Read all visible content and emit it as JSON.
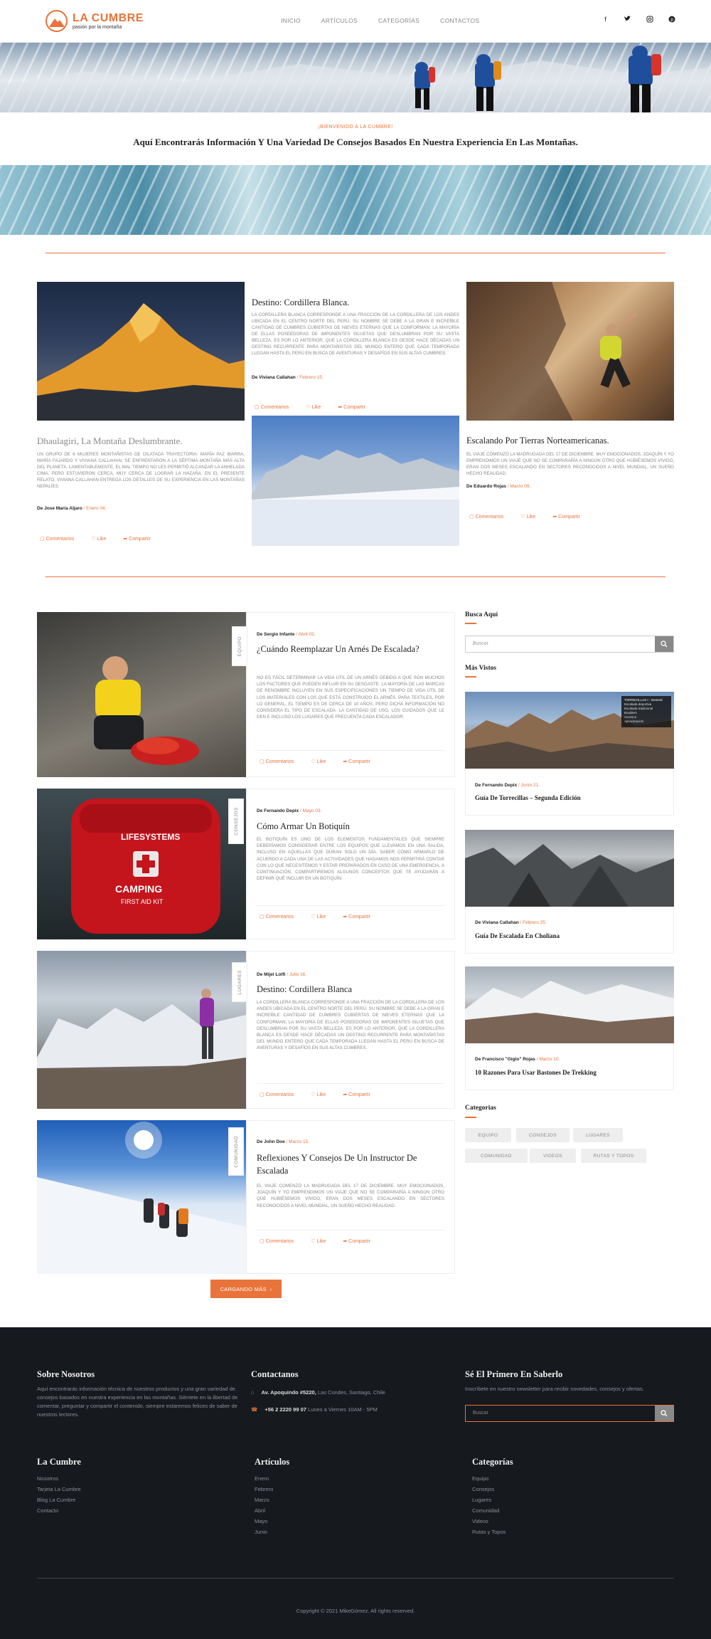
{
  "header": {
    "logo_title": "LA CUMBRE",
    "logo_sub": "pasión por la montaña",
    "nav": [
      "INICIO",
      "ARTÍCULOS",
      "CATEGORÍAS",
      "CONTACTOS"
    ],
    "social": [
      "facebook-icon",
      "twitter-icon",
      "instagram-icon",
      "pinterest-icon"
    ]
  },
  "welcome": {
    "small": "¡BIENVENIDO A LA CUMBRE!",
    "big": "Aquí Encontrarás Información Y Una Variedad De Consejos Basados En Nuestra Experiencia En Las Montañas."
  },
  "featured": [
    {
      "title": "Destino: Cordillera Blanca.",
      "desc": "La Cordillera Blanca corresponde a una fracción de la cordillera de los Andes ubicada en el centro norte del Perú. Su nombre se debe a la gran e increíble cantidad de cumbres cubiertas de nieves eternas que la conforman; la mayoría de ellas poseedoras de imponentes siluetas que deslumbran por su vasta belleza. Es por lo anterior, que la Cordillera Blanca es desde hace décadas un destino recurrente para montañistas del mundo entero que cada temporada llegan hasta el Perú en busca de aventuras y desafíos en sus altas cumbres.",
      "author": "De Viviana Callahan",
      "date": "Febrero 15.",
      "actions": [
        "Comentarios",
        "Like",
        "Compartir"
      ]
    },
    {
      "title": "Dhaulagiri, La Montaña Deslumbrante.",
      "desc": "Un grupo de 6 mujeres montañistas de dilatada trayectoria: María Paz Ibarra, María Fajardo y Viviana Callahan, se enfrentaron a la séptima montaña más alta del planeta. Lamentablemente, el mal tiempo no les permitió alcanzar la anhelada cima, pero estuvieron cerca, muy cerca de lograr la hazaña. En el presente relato, Viviana Callahan entrega los detalles de su experiencia en las montañas nepalíes.",
      "author": "De Jose María Aljaro",
      "date": "Enero 04.",
      "actions": [
        "Comentarios",
        "Like",
        "Compartir"
      ]
    },
    {
      "title": "Escalando Por Tierras Norteamericanas.",
      "desc": "El viaje comenzó la madrugada del 17 de diciembre. Muy emocionados, Joaquín y yo emprendimos un viaje que no se compararía a ningún otro que hubiésemos vivido, eran dos meses escalando en sectores reconocidos a nivel mundial, un sueño hecho realidad.",
      "author": "De Eduardo Rojas",
      "date": "Marzo 09.",
      "actions": [
        "Comentarios",
        "Like",
        "Compartir"
      ]
    }
  ],
  "posts": [
    {
      "tag": "EQUIPO",
      "author": "De Sergio Infante",
      "date": "Abril 03.",
      "title": "¿Cuándo Reemplazar Un Arnés De Escalada?",
      "desc": "No es fácil determinar la vida útil de un arnés debido a que son muchos los factores que pueden influir en su desgaste. La mayoría de las marcas de renombre incluyen en sus especificaciones un tiempo de vida útil de los materiales con los que está construido el arnés. Para textiles, por lo general, el tiempo es de cerca de 10 años, pero dicha información no considera el tipo de escalada, la cantidad de uso, los cuidados que le den e incluso los lugares que frecuenta cada escalador.",
      "actions": [
        "Comentarios",
        "Like",
        "Compartir"
      ]
    },
    {
      "tag": "CONSEJOS",
      "author": "De Fernando Depix",
      "date": "Mayo 03.",
      "title": "Cómo Armar Un Botiquín",
      "desc": "El botiquín es uno de los elementos fundamentales que siempre deberíamos considerar entre los equipos que llevamos en una salida, incluso en aquellas que duran solo un día. Saber cómo armarlo de acuerdo a cada una de las actividades que hagamos nos permitirá contar con lo que necesitemos y estar preparados en caso de una emergencia. A continuación, compartiremos algunos conceptos que te ayudarán a definir qué incluir en un botiquín.",
      "actions": [
        "Comentarios",
        "Like",
        "Compartir"
      ]
    },
    {
      "tag": "LUGARES",
      "author": "De Mijel Lotfi",
      "date": "Julio 16.",
      "title": "Destino: Cordillera Blanca",
      "desc": "La Cordillera Blanca corresponde a una fracción de la cordillera de los Andes ubicada en el centro norte del Perú. Su nombre se debe a la gran e increíble cantidad de cumbres cubiertas de nieves eternas que la conforman; la mayoría de ellas poseedoras de imponentes siluetas que deslumbran por su vasta belleza. Es por lo anterior, que la Cordillera Blanca es desde hace décadas un destino recurrente para montañistas del mundo entero que cada temporada llegan hasta el Perú en busca de aventuras y desafíos en sus altas cumbres.",
      "actions": [
        "Comentarios",
        "Like",
        "Compartir"
      ]
    },
    {
      "tag": "COMUNIDAD",
      "author": "De John Doe",
      "date": "Marzo 15.",
      "title": "Reflexiones Y Consejos De Un Instructor De Escalada",
      "desc": "El viaje comenzó la madrugada del 17 de diciembre. Muy emocionados, Joaquín y yo emprendimos un viaje que no se compararía a ningún otro que hubiésemos vivido, eran dos meses escalando en sectores reconocidos a nivel mundial, un sueño hecho realidad.",
      "actions": [
        "Comentarios",
        "Like",
        "Compartir"
      ]
    }
  ],
  "load_more": "CARGANDO MÁS",
  "sidebar": {
    "search_title": "Busca Aquí",
    "search_placeholder": "Buscar",
    "popular_title": "Más Vistos",
    "popular": [
      {
        "author": "De Fernando Depix",
        "date": "Junio 21.",
        "title": "Guía De Torrecillas – Segunda Edición",
        "overlay": [
          "TORRECILLAS I - General",
          "Escalada deportiva",
          "Escalada tradicional",
          "Boulders",
          "Accesos",
          "Aproximación"
        ]
      },
      {
        "author": "De Viviana Callahan",
        "date": "Febrero 25.",
        "title": "Guía De Escalada En Choliana"
      },
      {
        "author": "De Francisco \"Gigio\" Rojas",
        "date": "Marzo 10.",
        "title": "10 Razones Para Usar Bastones De Trekking"
      }
    ],
    "categories_title": "Categorias",
    "tags": [
      "EQUIPO",
      "CONSEJOS",
      "LUGARES",
      "COMUNIDAD",
      "VIDEOS",
      "RUTAS Y TOPOS"
    ]
  },
  "footer": {
    "about_title": "Sobre Nosotros",
    "about_text": "Aquí encontrarás información técnica de nuestros productos y una gran variedad de consejos basados en nuestra experiencia en las montañas. Siéntete en la libertad de comentar, preguntar y compartir el contenido, siempre estaremos felices de saber de nuestros lectores.",
    "contact_title": "Contactanos",
    "address_bold": "Av. Apoquindo #5220,",
    "address_rest": "Las Condes, Santiago, Chile",
    "phone_bold": "+56 2 2220 99 07",
    "phone_rest": "Lunes a Viernes 10AM - 5PM",
    "news_title": "Sé El Primero En Saberlo",
    "news_text": "Inscríbete en nuestro newsletter para recibir novedades, consejos y ofertas.",
    "news_placeholder": "Buscar",
    "col1_title": "La Cumbre",
    "col1": [
      "Nosotros",
      "Tarjeta La Cumbre",
      "Blog La Cumbre",
      "Contacto"
    ],
    "col2_title": "Artículos",
    "col2": [
      "Enero",
      "Febrero",
      "Marzo",
      "Abril",
      "Mayo",
      "Junio"
    ],
    "col3_title": "Categorías",
    "col3": [
      "Equipo",
      "Consejos",
      "Lugares",
      "Comunidad",
      "Videos",
      "Rutas y Topos"
    ],
    "copyright": "Copyright © 2021 MikeGómez. All rights reserved."
  },
  "colors": {
    "accent": "#e8743b",
    "footer_bg": "#16191e"
  }
}
